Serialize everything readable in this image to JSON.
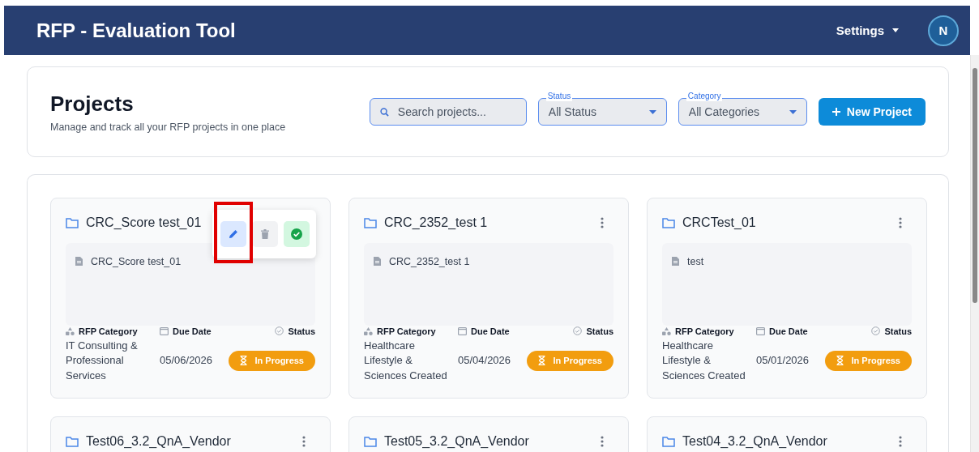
{
  "header": {
    "title": "RFP - Evaluation Tool",
    "settings": "Settings",
    "avatar": "N"
  },
  "toolbar": {
    "title": "Projects",
    "subtitle": "Manage and track all your RFP projects in one place",
    "search": {
      "placeholder": "Search projects..."
    },
    "filters": [
      {
        "label": "Status",
        "value": "All Status"
      },
      {
        "label": "Category",
        "value": "All Categories"
      }
    ],
    "new_button": "New Project"
  },
  "projects": [
    {
      "name": "CRC_Score test_01",
      "menu_open": true,
      "actions": [
        {
          "kind": "edit",
          "highlighted": true
        },
        {
          "kind": "delete",
          "highlighted": false
        },
        {
          "kind": "complete",
          "highlighted": false
        }
      ],
      "description": "CRC_Score test_01",
      "category_label": "RFP Category",
      "category": "IT Consulting & Professional Services",
      "due_label": "Due Date",
      "due": "05/06/2026",
      "status_label": "Status",
      "status": "In Progress"
    },
    {
      "name": "CRC_2352_test 1",
      "menu_open": false,
      "description": "CRC_2352_test 1",
      "category_label": "RFP Category",
      "category": "Healthcare Lifestyle & Sciences Created",
      "due_label": "Due Date",
      "due": "05/04/2026",
      "status_label": "Status",
      "status": "In Progress"
    },
    {
      "name": "CRCTest_01",
      "menu_open": false,
      "description": "test",
      "category_label": "RFP Category",
      "category": "Healthcare Lifestyle & Sciences Created",
      "due_label": "Due Date",
      "due": "05/01/2026",
      "status_label": "Status",
      "status": "In Progress"
    },
    {
      "name": "Test06_3.2_QnA_Vendor",
      "menu_open": false
    },
    {
      "name": "Test05_3.2_QnA_Vendor",
      "menu_open": false
    },
    {
      "name": "Test04_3.2_QnA_Vendor",
      "menu_open": false
    }
  ]
}
